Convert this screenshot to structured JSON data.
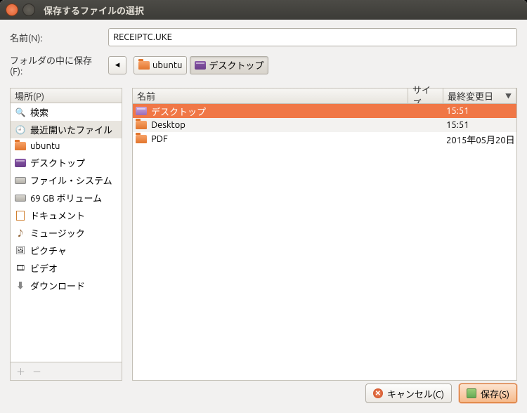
{
  "titlebar": {
    "title": "保存するファイルの選択"
  },
  "name_row": {
    "label": "名前(N):",
    "value": "RECEIPTC.UKE"
  },
  "folder_row": {
    "label": "フォルダの中に保存(F):",
    "back_glyph": "◂",
    "crumbs": [
      {
        "label": "ubuntu",
        "icon": "folder-orange"
      },
      {
        "label": "デスクトップ",
        "icon": "folder-purple"
      }
    ]
  },
  "places": {
    "header": "場所(P)",
    "items": [
      {
        "label": "検索",
        "icon": "search"
      },
      {
        "label": "最近開いたファイル",
        "icon": "clock",
        "selected": true
      },
      {
        "label": "ubuntu",
        "icon": "folder-orange"
      },
      {
        "label": "デスクトップ",
        "icon": "folder-purple"
      },
      {
        "label": "ファイル・システム",
        "icon": "drive"
      },
      {
        "label": "69 GB ボリューム",
        "icon": "drive"
      },
      {
        "label": "ドキュメント",
        "icon": "doc"
      },
      {
        "label": "ミュージック",
        "icon": "music"
      },
      {
        "label": "ピクチャ",
        "icon": "img"
      },
      {
        "label": "ビデオ",
        "icon": "video"
      },
      {
        "label": "ダウンロード",
        "icon": "dl"
      }
    ],
    "footer": {
      "add": "＋",
      "remove": "－"
    }
  },
  "files": {
    "headers": {
      "name": "名前",
      "size": "サイズ",
      "date": "最終変更日",
      "sort_glyph": "▼"
    },
    "rows": [
      {
        "name": "デスクトップ",
        "icon": "folder-purple",
        "size": "",
        "date": "15:51",
        "selected": true
      },
      {
        "name": "Desktop",
        "icon": "folder-orange",
        "size": "",
        "date": "15:51",
        "alt": true
      },
      {
        "name": "PDF",
        "icon": "folder-orange",
        "size": "",
        "date": "2015年05月20日"
      }
    ]
  },
  "buttons": {
    "cancel": "キャンセル(C)",
    "save": "保存(S)"
  }
}
